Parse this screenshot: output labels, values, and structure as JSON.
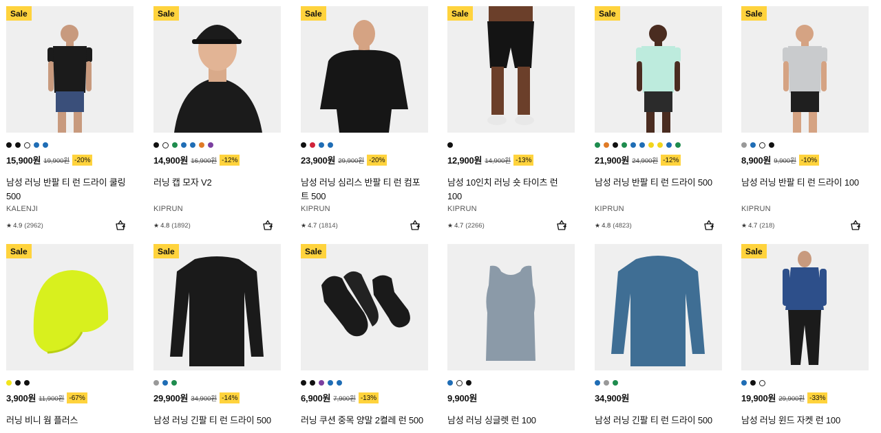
{
  "sale_label": "Sale",
  "products": [
    {
      "sale": true,
      "colors": [
        "#111111",
        "#111111",
        "#ffffff",
        "#1f6db5",
        "#1f6db5"
      ],
      "price": "15,900원",
      "original": "19,900원",
      "discount": "-20%",
      "title": "남성 러닝 반팔 티 런 드라이 쿨링 500",
      "brand": "KALENJI",
      "rating": "4.9",
      "reviews": "(2962)",
      "image": "man-black-tshirt-shorts"
    },
    {
      "sale": true,
      "colors": [
        "#111111",
        "#ffffff",
        "#1e8c4e",
        "#1f6db5",
        "#1f6db5",
        "#e07b26",
        "#7b3fa0"
      ],
      "price": "14,900원",
      "original": "16,900원",
      "discount": "-12%",
      "title": "러닝 캡 모자 V2",
      "brand": "KIPRUN",
      "rating": "4.8",
      "reviews": "(1892)",
      "image": "man-black-cap"
    },
    {
      "sale": true,
      "colors": [
        "#111111",
        "#d0243a",
        "#1f6db5",
        "#1f6db5"
      ],
      "price": "23,900원",
      "original": "29,900원",
      "discount": "-20%",
      "title": "남성 러닝 심리스 반팔 티 런 컴포트 500",
      "brand": "KIPRUN",
      "rating": "4.7",
      "reviews": "(1814)",
      "image": "man-black-tshirt"
    },
    {
      "sale": true,
      "colors": [
        "#111111"
      ],
      "price": "12,900원",
      "original": "14,900원",
      "discount": "-13%",
      "title": "남성 10인치 러닝 숏 타이츠 런 100",
      "brand": "KIPRUN",
      "rating": "4.7",
      "reviews": "(2266)",
      "image": "legs-black-tights"
    },
    {
      "sale": true,
      "colors": [
        "#1e8c4e",
        "#e07b26",
        "#111111",
        "#1e8c4e",
        "#1f6db5",
        "#1f6db5",
        "#f2d51c",
        "#f2d51c",
        "#1f6db5",
        "#1e8c4e"
      ],
      "price": "21,900원",
      "original": "24,900원",
      "discount": "-12%",
      "title": "남성 러닝 반팔 티 런 드라이 500",
      "brand": "KIPRUN",
      "rating": "4.8",
      "reviews": "(4823)",
      "image": "man-mint-tshirt"
    },
    {
      "sale": true,
      "colors": [
        "#999999",
        "#1f6db5",
        "#ffffff",
        "#111111"
      ],
      "price": "8,900원",
      "original": "9,900원",
      "discount": "-10%",
      "title": "남성 러닝 반팔 티 런 드라이 100",
      "brand": "KIPRUN",
      "rating": "4.7",
      "reviews": "(218)",
      "image": "man-grey-tshirt"
    },
    {
      "sale": true,
      "colors": [
        "#f2e51c",
        "#111111",
        "#111111"
      ],
      "price": "3,900원",
      "original": "11,900원",
      "discount": "-67%",
      "title": "러닝 비니 웜 플러스",
      "brand": "",
      "rating": "",
      "reviews": "",
      "image": "neon-beanie"
    },
    {
      "sale": true,
      "colors": [
        "#999999",
        "#1f6db5",
        "#1e8c4e"
      ],
      "price": "29,900원",
      "original": "34,900원",
      "discount": "-14%",
      "title": "남성 러닝 긴팔 티 런 드라이 500",
      "brand": "",
      "rating": "",
      "reviews": "",
      "image": "black-longsleeve"
    },
    {
      "sale": true,
      "colors": [
        "#111111",
        "#111111",
        "#7b3fa0",
        "#1f6db5",
        "#1f6db5"
      ],
      "price": "6,900원",
      "original": "7,900원",
      "discount": "-13%",
      "title": "러닝 쿠션 중목 양말 2켤레 런 500",
      "brand": "",
      "rating": "",
      "reviews": "",
      "image": "black-socks"
    },
    {
      "sale": false,
      "colors": [
        "#1f6db5",
        "#ffffff",
        "#111111"
      ],
      "price": "9,900원",
      "original": "",
      "discount": "",
      "title": "남성 러닝 싱글렛 런 100",
      "brand": "",
      "rating": "",
      "reviews": "",
      "image": "grey-singlet"
    },
    {
      "sale": false,
      "colors": [
        "#1f6db5",
        "#999999",
        "#1e8c4e"
      ],
      "price": "34,900원",
      "original": "",
      "discount": "",
      "title": "남성 러닝 긴팔 티 런 드라이 500",
      "brand": "",
      "rating": "",
      "reviews": "",
      "image": "blue-longsleeve"
    },
    {
      "sale": true,
      "colors": [
        "#1f6db5",
        "#111111",
        "#ffffff"
      ],
      "price": "19,900원",
      "original": "29,900원",
      "discount": "-33%",
      "title": "남성 러닝 윈드 자켓 런 100",
      "brand": "",
      "rating": "",
      "reviews": "",
      "image": "man-blue-jacket"
    }
  ]
}
